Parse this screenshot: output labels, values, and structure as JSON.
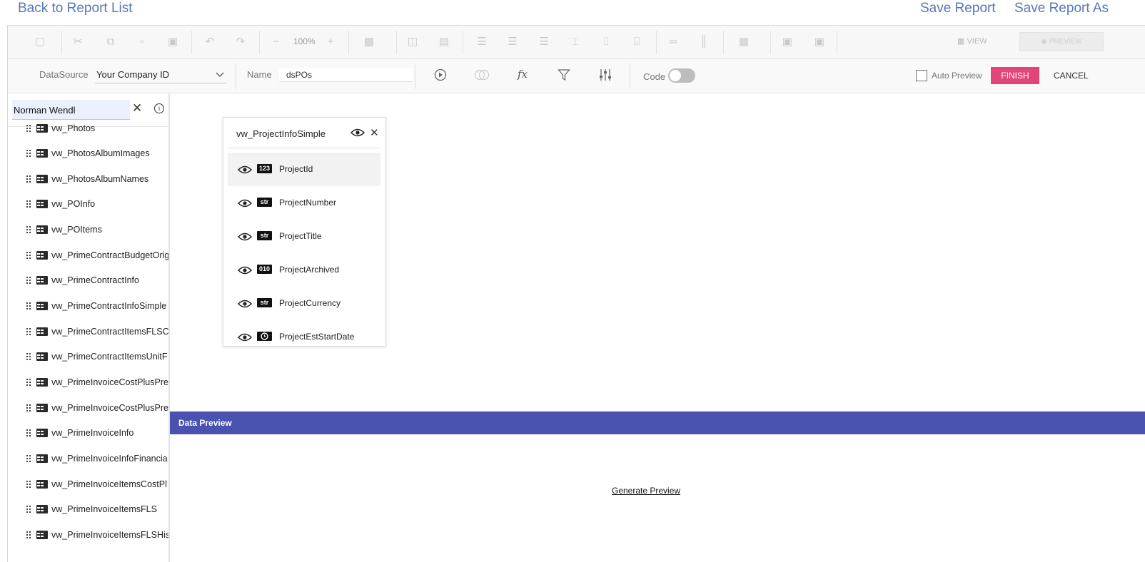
{
  "header": {
    "back_link": "Back to Report List",
    "save_report": "Save Report",
    "save_report_as": "Save Report As"
  },
  "toolbar": {
    "zoom": "100%",
    "view_label": "VIEW",
    "preview_label": "PREVIEW"
  },
  "datasource_bar": {
    "datasource_label": "DataSource",
    "datasource_value": "Your Company ID",
    "name_label": "Name",
    "name_value": "dsPOs",
    "code_label": "Code",
    "code_enabled": false,
    "auto_preview_label": "Auto Preview",
    "auto_preview_checked": false,
    "finish_label": "FINISH",
    "cancel_label": "CANCEL",
    "finish_color": "#e2457a"
  },
  "sidebar": {
    "search_value": "Norman Wendl",
    "items": [
      "vw_Photos",
      "vw_PhotosAlbumImages",
      "vw_PhotosAlbumNames",
      "vw_POInfo",
      "vw_POItems",
      "vw_PrimeContractBudgetOrig",
      "vw_PrimeContractInfo",
      "vw_PrimeContractInfoSimple",
      "vw_PrimeContractItemsFLSC",
      "vw_PrimeContractItemsUnitF",
      "vw_PrimeInvoiceCostPlusPre",
      "vw_PrimeInvoiceCostPlusPre",
      "vw_PrimeInvoiceInfo",
      "vw_PrimeInvoiceInfoFinancia",
      "vw_PrimeInvoiceItemsCostPl",
      "vw_PrimeInvoiceItemsFLS",
      "vw_PrimeInvoiceItemsFLSHis"
    ]
  },
  "field_panel": {
    "title": "vw_ProjectInfoSimple",
    "fields": [
      {
        "type": "123",
        "name": "ProjectId",
        "selected": true
      },
      {
        "type": "str",
        "name": "ProjectNumber",
        "selected": false
      },
      {
        "type": "str",
        "name": "ProjectTitle",
        "selected": false
      },
      {
        "type": "010",
        "name": "ProjectArchived",
        "selected": false
      },
      {
        "type": "str",
        "name": "ProjectCurrency",
        "selected": false
      },
      {
        "type": "clock",
        "name": "ProjectEstStartDate",
        "selected": false
      }
    ]
  },
  "data_preview": {
    "header": "Data Preview",
    "generate_label": "Generate Preview",
    "header_color": "#4a52b0"
  }
}
